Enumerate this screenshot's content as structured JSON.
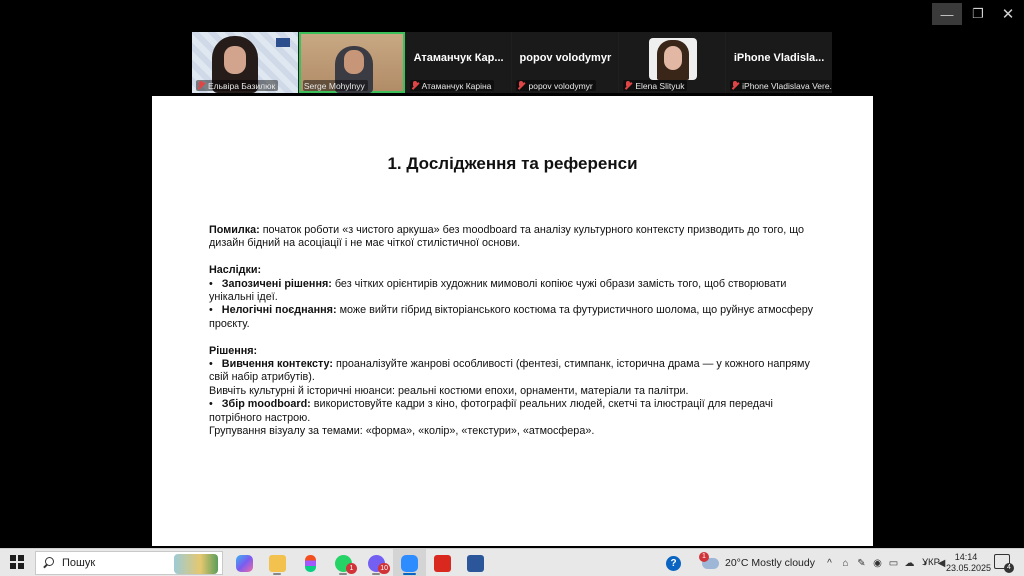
{
  "window_controls": {
    "minimize": "—",
    "restore": "❐",
    "close": "✕"
  },
  "participants": [
    {
      "name": "Ельвіра Базилюк",
      "video": true
    },
    {
      "name": "Serge Mohylnyy",
      "video": true,
      "active_speaker": true
    },
    {
      "display": "Атаманчук  Кар...",
      "name": "Атаманчук Каріна",
      "video": false
    },
    {
      "display": "popov volodymyr",
      "name": "popov volodymyr",
      "video": false
    },
    {
      "name": "Elena Slityuk",
      "video": true
    },
    {
      "display": "iPhone  Vladisla...",
      "name": "iPhone Vladislava Vere...",
      "video": false
    }
  ],
  "slide": {
    "title": "1. Дослідження та референси",
    "error_label": "Помилка:",
    "error_text": " початок роботи «з чистого аркуша» без moodboard та аналізу культурного контексту призводить до того, що дизайн бідний на асоціації і не має чіткої стилістичної основи.",
    "consequences_label": "Наслідки:",
    "cons1_label": "Запозичені рішення:",
    "cons1_text": " без чітких орієнтирів художник мимоволі копіює чужі образи замість того, щоб створювати унікальні ідеї.",
    "cons2_label": "Нелогічні поєднання:",
    "cons2_text": " може вийти гібрид вікторіанського костюма та футуристичного шолома, що руйнує атмосферу проєкту.",
    "solution_label": "Рішення:",
    "sol1_label": "Вивчення контексту:",
    "sol1_text": " проаналізуйте жанрові особливості (фентезі, стимпанк, історична драма — у кожного напряму свій набір атрибутів).",
    "sol1_extra": "Вивчіть культурні й історичні нюанси: реальні костюми епохи, орнаменти, матеріали та палітри.",
    "sol2_label": "Збір moodboard:",
    "sol2_text": " використовуйте кадри з кіно, фотографії реальних людей, скетчі та ілюстрації для передачі потрібного настрою.",
    "sol2_extra": "Групування візуалу за темами: «форма», «колір», «текстури», «атмосфера».",
    "bullet": "•"
  },
  "taskbar": {
    "search_placeholder": "Пошук",
    "apps": [
      {
        "name": "copilot",
        "color": "#7a5cf0"
      },
      {
        "name": "file-explorer",
        "color": "#f2c14e"
      },
      {
        "name": "figma",
        "color": "#f24e1e"
      },
      {
        "name": "whatsapp",
        "color": "#25d366",
        "badge": "1"
      },
      {
        "name": "viber",
        "color": "#7360f2",
        "badge": "10"
      },
      {
        "name": "zoom",
        "color": "#2d8cff"
      },
      {
        "name": "acrobat",
        "color": "#d9281e"
      },
      {
        "name": "word",
        "color": "#2b579a"
      }
    ],
    "help_icon": "?",
    "weather_badge": "1",
    "weather": "20°C  Mostly cloudy",
    "tray_icons": [
      "^",
      "⌂",
      "✎",
      "◉",
      "▭",
      "☁",
      "◗",
      "◀"
    ],
    "language": "УКР",
    "time": "14:14",
    "date": "23.05.2025",
    "notifications": "4"
  }
}
